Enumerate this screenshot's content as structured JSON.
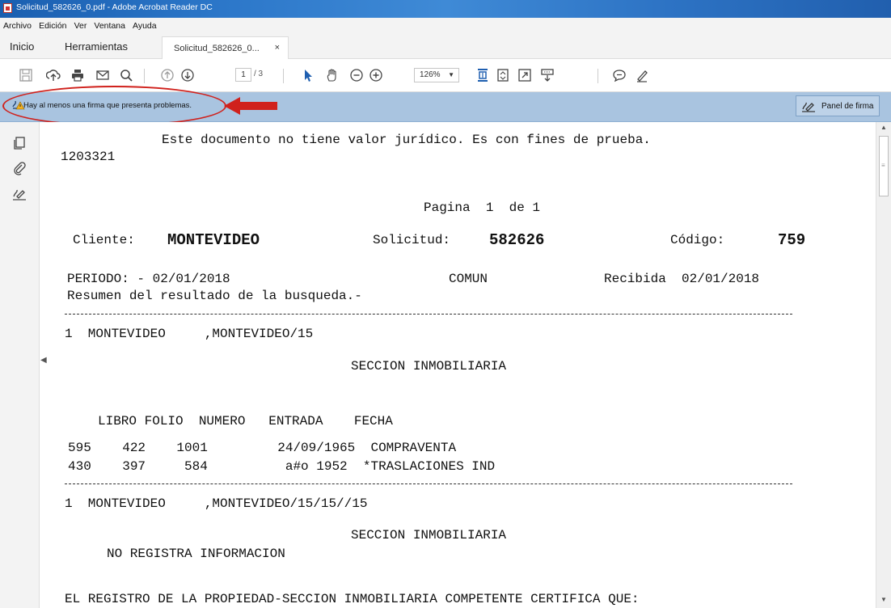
{
  "window": {
    "title": "Solicitud_582626_0.pdf - Adobe Acrobat Reader DC"
  },
  "menu": [
    "Archivo",
    "Edición",
    "Ver",
    "Ventana",
    "Ayuda"
  ],
  "tabs": {
    "home": "Inicio",
    "tools": "Herramientas",
    "doc": "Solicitud_582626_0...",
    "close": "×"
  },
  "toolbar": {
    "page_current": "1",
    "page_total": "/ 3",
    "zoom": "126%"
  },
  "signature_bar": {
    "message": "Hay al menos una firma que presenta problemas.",
    "panel_button": "Panel de firma"
  },
  "colors": {
    "accent_red": "#d0211c",
    "signature_bar": "#a9c4e0",
    "titlebar": "#2c77c9"
  },
  "icons": [
    "save-icon",
    "upload-icon",
    "print-icon",
    "email-icon",
    "search-icon",
    "page-up-icon",
    "page-down-icon",
    "select-arrow-icon",
    "hand-icon",
    "zoom-out-icon",
    "zoom-in-icon",
    "fit-page-icon",
    "page-view-icon",
    "full-screen-icon",
    "scroll-mode-icon",
    "comment-icon",
    "sign-pen-icon",
    "thumbnails-icon",
    "attachment-icon",
    "signature-icon",
    "warning-icon"
  ],
  "document": {
    "disclaimer": "Este documento no tiene valor jurídico. Es con fines de prueba.",
    "id": "1203321",
    "page_line": "Pagina  1  de 1",
    "cliente_label": "Cliente:",
    "cliente_value": "MONTEVIDEO",
    "solicitud_label": "Solicitud:",
    "solicitud_value": "582626",
    "codigo_label": "Código:",
    "codigo_value": "759",
    "periodo": "PERIODO: - 02/01/2018",
    "comun": "COMUN",
    "recibida": "Recibida  02/01/2018",
    "resumen": "Resumen del resultado de la busqueda.-",
    "entry1": "1  MONTEVIDEO     ,MONTEVIDEO/15",
    "seccion1": "SECCION INMOBILIARIA",
    "table_header": "LIBRO FOLIO  NUMERO   ENTRADA    FECHA",
    "row1": "595    422    1001         24/09/1965  COMPRAVENTA",
    "row2": "430    397     584          a#o 1952  *TRASLACIONES IND",
    "entry2": "1  MONTEVIDEO     ,MONTEVIDEO/15/15//15",
    "seccion2": "SECCION INMOBILIARIA",
    "no_registra": "NO REGISTRA INFORMACION",
    "certifica": "EL REGISTRO DE LA PROPIEDAD-SECCION INMOBILIARIA COMPETENTE CERTIFICA QUE:"
  }
}
